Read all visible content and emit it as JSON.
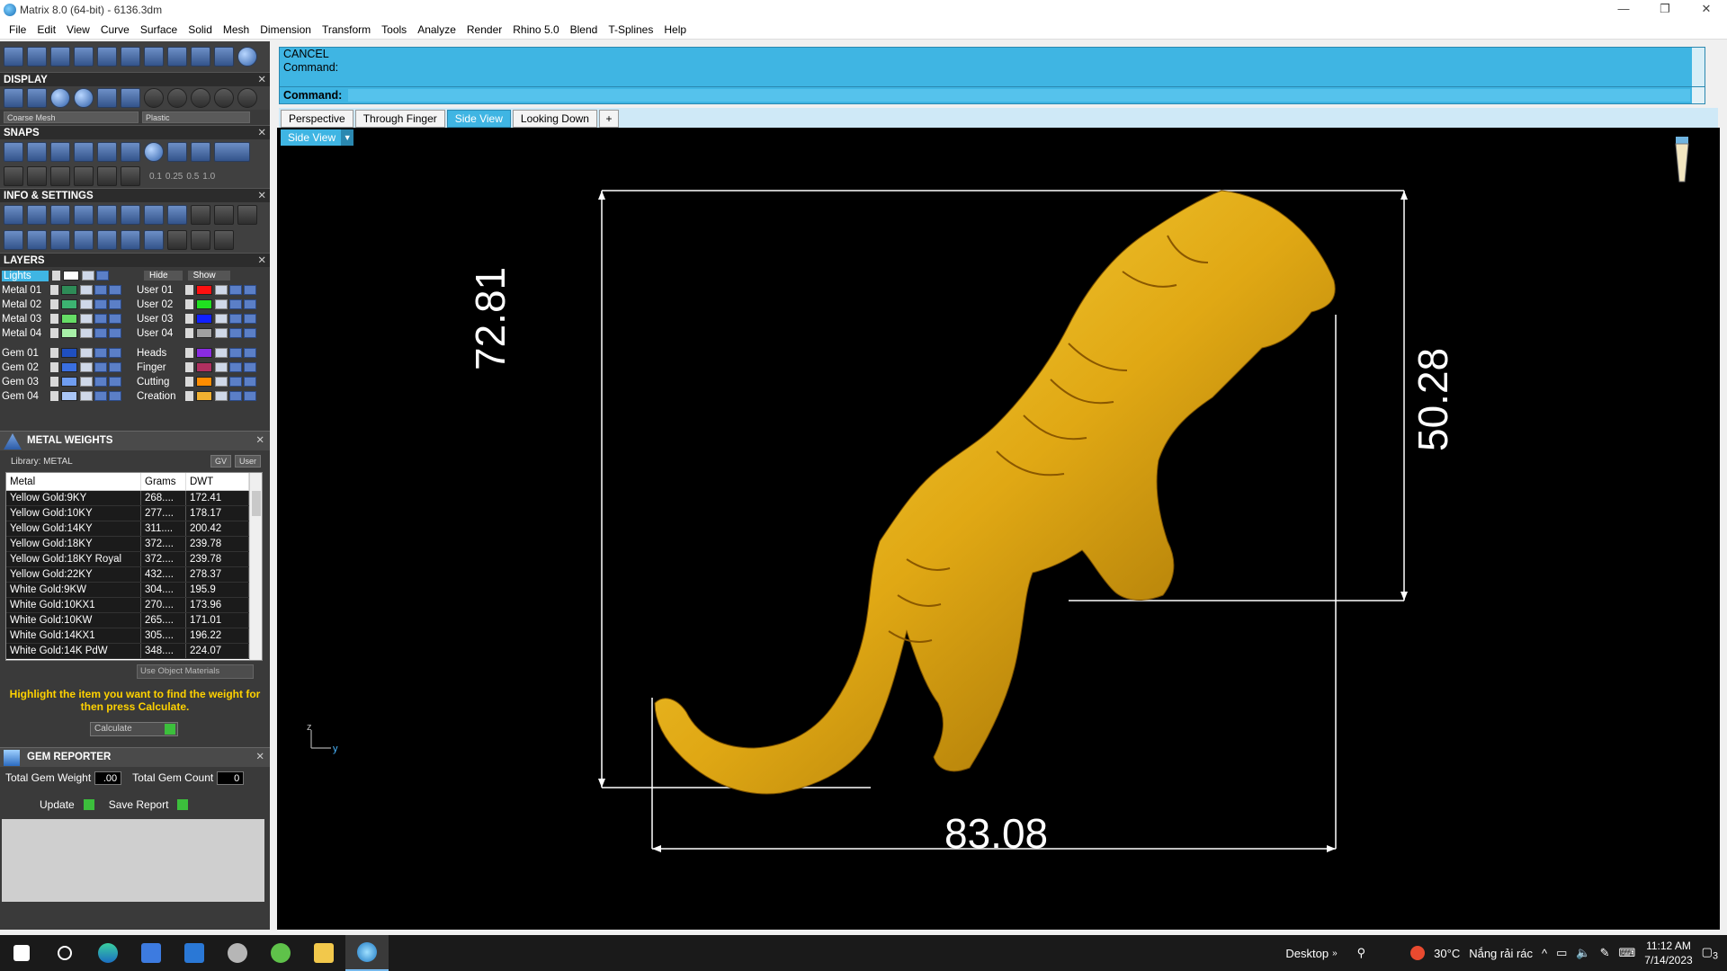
{
  "window": {
    "title": "Matrix 8.0 (64-bit) - 6136.3dm",
    "minimize": "—",
    "maximize": "❐",
    "close": "✕"
  },
  "menu": [
    "File",
    "Edit",
    "View",
    "Curve",
    "Surface",
    "Solid",
    "Mesh",
    "Dimension",
    "Transform",
    "Tools",
    "Analyze",
    "Render",
    "Rhino 5.0",
    "Blend",
    "T-Splines",
    "Help"
  ],
  "panels": {
    "display": {
      "title": "DISPLAY",
      "mesh": "Coarse Mesh",
      "material": "Plastic"
    },
    "snaps": {
      "title": "SNAPS",
      "values": [
        "0.1",
        "0.25",
        "0.5",
        "1.0"
      ]
    },
    "info": {
      "title": "INFO & SETTINGS"
    },
    "layers": {
      "title": "LAYERS",
      "lights": "Lights",
      "hide": "Hide",
      "show": "Show",
      "left": [
        {
          "name": "Metal 01",
          "color": "#2e8b57"
        },
        {
          "name": "Metal 02",
          "color": "#3cb371"
        },
        {
          "name": "Metal 03",
          "color": "#66dd66"
        },
        {
          "name": "Metal 04",
          "color": "#a8f0a8"
        },
        {
          "name": "Gem 01",
          "color": "#1f4fbf"
        },
        {
          "name": "Gem 02",
          "color": "#3a6fe0"
        },
        {
          "name": "Gem 03",
          "color": "#6f9df0"
        },
        {
          "name": "Gem 04",
          "color": "#a9c6f7"
        }
      ],
      "right": [
        {
          "name": "User 01",
          "color": "#ff1010"
        },
        {
          "name": "User 02",
          "color": "#20e020"
        },
        {
          "name": "User 03",
          "color": "#1020ff"
        },
        {
          "name": "User 04",
          "color": "#a0a0a0"
        },
        {
          "name": "Heads",
          "color": "#8a2be2"
        },
        {
          "name": "Finger",
          "color": "#b03060"
        },
        {
          "name": "Cutting",
          "color": "#ff8c00"
        },
        {
          "name": "Creation",
          "color": "#f0b030"
        }
      ]
    },
    "metal_weights": {
      "title": "METAL WEIGHTS",
      "library": "Library: METAL",
      "gv": "GV",
      "user": "User",
      "headers": [
        "Metal",
        "Grams",
        "DWT"
      ],
      "rows": [
        [
          "Yellow Gold:9KY",
          "268....",
          "172.41"
        ],
        [
          "Yellow Gold:10KY",
          "277....",
          "178.17"
        ],
        [
          "Yellow Gold:14KY",
          "311....",
          "200.42"
        ],
        [
          "Yellow Gold:18KY",
          "372....",
          "239.78"
        ],
        [
          "Yellow Gold:18KY Royal",
          "372....",
          "239.78"
        ],
        [
          "Yellow Gold:22KY",
          "432....",
          "278.37"
        ],
        [
          "White Gold:9KW",
          "304....",
          "195.9"
        ],
        [
          "White Gold:10KX1",
          "270....",
          "173.96"
        ],
        [
          "White Gold:10KW",
          "265....",
          "171.01"
        ],
        [
          "White Gold:14KX1",
          "305....",
          "196.22"
        ],
        [
          "White Gold:14K PdW",
          "348....",
          "224.07"
        ]
      ],
      "use_object_materials": "Use Object Materials",
      "hint": "Highlight the item you want to find the weight for then press Calculate.",
      "calculate": "Calculate"
    },
    "gem_reporter": {
      "title": "GEM REPORTER",
      "total_weight_label": "Total Gem Weight",
      "total_weight": ".00",
      "total_count_label": "Total Gem Count",
      "total_count": "0",
      "update": "Update",
      "save_report": "Save Report"
    }
  },
  "command": {
    "history": [
      "CANCEL",
      "Command:"
    ],
    "prompt": "Command:"
  },
  "tabs": [
    "Perspective",
    "Through Finger",
    "Side View",
    "Looking Down",
    "+"
  ],
  "active_tab": "Side View",
  "viewport": {
    "label": "Side View",
    "dimensions": {
      "height": "72.81",
      "right_height": "50.28",
      "width": "83.08"
    },
    "axis": {
      "z": "z",
      "y": "y"
    },
    "model_color": "#e0a814"
  },
  "taskbar": {
    "desktop": "Desktop",
    "weather": "30°C",
    "weather_text": "Nắng rải rác",
    "time": "11:12 AM",
    "date": "7/14/2023",
    "notifications": "3"
  }
}
